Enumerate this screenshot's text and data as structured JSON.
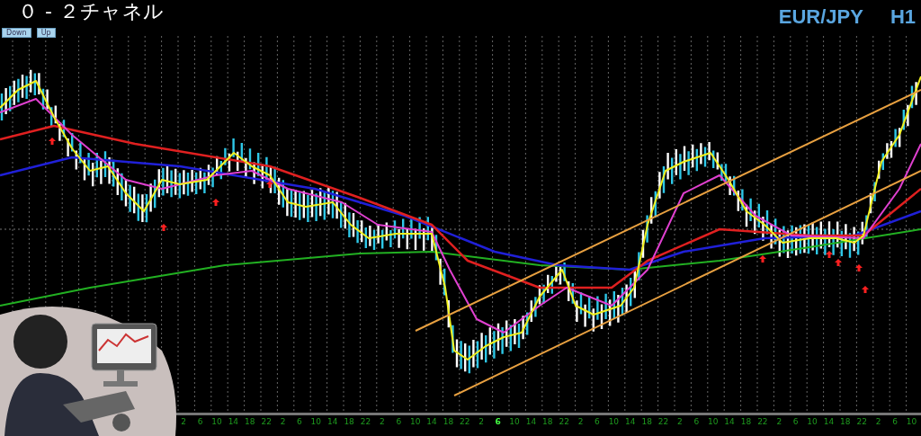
{
  "title": "０ - ２チャネル",
  "chart_buttons": [
    {
      "label": "Down"
    },
    {
      "label": "Up"
    }
  ],
  "symbol": "EUR/JPY",
  "timeframe": "H1",
  "time_axis": [
    {
      "label": "2",
      "highlighted": false
    },
    {
      "label": "6",
      "highlighted": false
    },
    {
      "label": "10",
      "highlighted": false
    },
    {
      "label": "14",
      "highlighted": false
    },
    {
      "label": "18",
      "highlighted": false
    },
    {
      "label": "22",
      "highlighted": false
    },
    {
      "label": "2",
      "highlighted": false
    },
    {
      "label": "6",
      "highlighted": false
    },
    {
      "label": "10",
      "highlighted": false
    },
    {
      "label": "14",
      "highlighted": false
    },
    {
      "label": "18",
      "highlighted": false
    },
    {
      "label": "22",
      "highlighted": false
    },
    {
      "label": "2",
      "highlighted": false
    },
    {
      "label": "6",
      "highlighted": false
    },
    {
      "label": "10",
      "highlighted": false
    },
    {
      "label": "14",
      "highlighted": false
    },
    {
      "label": "18",
      "highlighted": false
    },
    {
      "label": "22",
      "highlighted": false
    },
    {
      "label": "2",
      "highlighted": false
    },
    {
      "label": "6",
      "highlighted": true
    },
    {
      "label": "10",
      "highlighted": false
    },
    {
      "label": "14",
      "highlighted": false
    },
    {
      "label": "18",
      "highlighted": false
    },
    {
      "label": "22",
      "highlighted": false
    },
    {
      "label": "2",
      "highlighted": false
    },
    {
      "label": "6",
      "highlighted": false
    },
    {
      "label": "10",
      "highlighted": false
    },
    {
      "label": "14",
      "highlighted": false
    },
    {
      "label": "18",
      "highlighted": false
    },
    {
      "label": "22",
      "highlighted": false
    },
    {
      "label": "2",
      "highlighted": false
    },
    {
      "label": "6",
      "highlighted": false
    },
    {
      "label": "10",
      "highlighted": false
    },
    {
      "label": "14",
      "highlighted": false
    },
    {
      "label": "18",
      "highlighted": false
    },
    {
      "label": "22",
      "highlighted": false
    },
    {
      "label": "2",
      "highlighted": false
    },
    {
      "label": "6",
      "highlighted": false
    },
    {
      "label": "10",
      "highlighted": false
    },
    {
      "label": "14",
      "highlighted": false
    },
    {
      "label": "18",
      "highlighted": false
    },
    {
      "label": "22",
      "highlighted": false
    },
    {
      "label": "2",
      "highlighted": false
    },
    {
      "label": "6",
      "highlighted": false
    },
    {
      "label": "10",
      "highlighted": false
    }
  ]
}
